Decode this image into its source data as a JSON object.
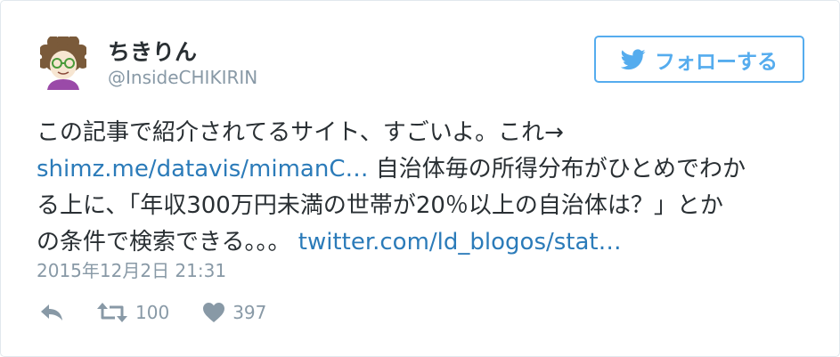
{
  "user": {
    "display_name": "ちきりん",
    "handle": "@InsideCHIKIRIN",
    "avatar_icon": "avatar-illustration"
  },
  "follow_button": {
    "label": "フォローする",
    "icon": "twitter-bird-icon"
  },
  "tweet": {
    "line1": "この記事で紹介されてるサイト、すごいよ。これ→",
    "link1": "shimz.me/datavis/mimanC…",
    "line2_rest": " 自治体毎の所得分布がひとめでわか",
    "line3": "る上に、「年収300万円未満の世帯が20％以上の自治体は？」とか",
    "line4_prefix": "の条件で検索できる。。。 ",
    "link2": "twitter.com/ld_blogos/stat…",
    "timestamp": "2015年12月2日 21:31"
  },
  "actions": {
    "retweet_count": "100",
    "like_count": "397"
  },
  "colors": {
    "accent": "#55acee",
    "link": "#2b7bb9",
    "muted": "#8899a6",
    "text": "#292f33",
    "border": "#e1e8ed"
  }
}
